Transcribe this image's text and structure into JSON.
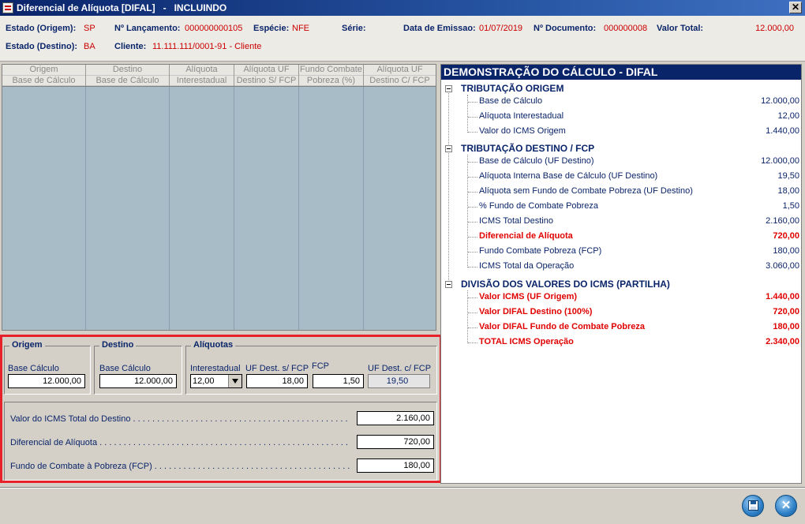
{
  "window": {
    "title": "Diferencial de Alíquota [DIFAL]",
    "separator": "-",
    "mode": "INCLUINDO",
    "close_glyph": "✕"
  },
  "header": {
    "estado_origem_label": "Estado (Origem):",
    "estado_origem": "SP",
    "lancamento_label": "Nº Lançamento:",
    "lancamento": "000000000105",
    "especie_label": "Espécie:",
    "especie": "NFE",
    "serie_label": "Série:",
    "data_emissao_label": "Data de Emissao:",
    "data_emissao": "01/07/2019",
    "documento_label": "Nº Documento:",
    "documento": "000000008",
    "valor_total_label": "Valor Total:",
    "valor_total": "12.000,00",
    "estado_destino_label": "Estado (Destino):",
    "estado_destino": "BA",
    "cliente_label": "Cliente:",
    "cliente": "11.111.111/0001-91 - Cliente"
  },
  "grid": {
    "columns": [
      {
        "line1": "Origem",
        "line2": "Base de Cálculo"
      },
      {
        "line1": "Destino",
        "line2": "Base de Cálculo"
      },
      {
        "line1": "Alíquota",
        "line2": "Interestadual"
      },
      {
        "line1": "Alíquota UF",
        "line2": "Destino S/ FCP"
      },
      {
        "line1": "Fundo Combate",
        "line2": "Pobreza (%)"
      },
      {
        "line1": "Alíquota UF",
        "line2": "Destino C/ FCP"
      }
    ]
  },
  "form": {
    "origem": {
      "legend": "Origem",
      "base_label": "Base Cálculo",
      "base_value": "12.000,00"
    },
    "destino": {
      "legend": "Destino",
      "base_label": "Base Cálculo",
      "base_value": "12.000,00"
    },
    "aliquotas": {
      "legend": "Alíquotas",
      "interestadual_label": "Interestadual",
      "interestadual_value": "12,00",
      "uf_sfcp_label": "UF Dest. s/ FCP",
      "uf_sfcp_value": "18,00",
      "fcp_label": "FCP",
      "fcp_value": "1,50",
      "uf_cfcp_label": "UF Dest. c/ FCP",
      "uf_cfcp_value": "19,50"
    },
    "totals": [
      {
        "label": "Valor do ICMS Total do Destino . . . . . . . . . . . . . . . . . . . . . . . . . . . . . . . . . . . . . . . . . . . . . . . . . . :",
        "value": "2.160,00"
      },
      {
        "label": "Diferencial de Alíquota . . . . . . . . . . . . . . . . . . . . . . . . . . . . . . . . . . . . . . . . . . . . . . . . . . . . . . . . . . :",
        "value": "720,00"
      },
      {
        "label": "Fundo de Combate à Pobreza (FCP) . . . . . . . . . . . . . . . . . . . . . . . . . . . . . . . . . . . . . . . . . . . . . . . :",
        "value": "180,00"
      }
    ]
  },
  "demo": {
    "title": "DEMONSTRAÇÃO DO CÁLCULO - DIFAL",
    "sections": [
      {
        "title": "TRIBUTAÇÃO ORIGEM",
        "rows": [
          {
            "label": "Base de Cálculo",
            "value": "12.000,00",
            "highlight": false
          },
          {
            "label": "Alíquota Interestadual",
            "value": "12,00",
            "highlight": false
          },
          {
            "label": "Valor do ICMS Origem",
            "value": "1.440,00",
            "highlight": false
          }
        ]
      },
      {
        "title": "TRIBUTAÇÃO DESTINO / FCP",
        "rows": [
          {
            "label": "Base de Cálculo (UF Destino)",
            "value": "12.000,00",
            "highlight": false
          },
          {
            "label": "Alíquota Interna Base de Cálculo (UF Destino)",
            "value": "19,50",
            "highlight": false
          },
          {
            "label": "Alíquota sem Fundo de Combate Pobreza (UF Destino)",
            "value": "18,00",
            "highlight": false
          },
          {
            "label": "% Fundo de Combate Pobreza",
            "value": "1,50",
            "highlight": false
          },
          {
            "label": "ICMS Total Destino",
            "value": "2.160,00",
            "highlight": false
          },
          {
            "label": "Diferencial de Alíquota",
            "value": "720,00",
            "highlight": true
          },
          {
            "label": "Fundo Combate Pobreza (FCP)",
            "value": "180,00",
            "highlight": false
          },
          {
            "label": "ICMS Total da Operação",
            "value": "3.060,00",
            "highlight": false
          }
        ]
      },
      {
        "title": "DIVISÃO DOS VALORES DO ICMS (PARTILHA)",
        "rows": [
          {
            "label": "Valor ICMS (UF Origem)",
            "value": "1.440,00",
            "highlight": true
          },
          {
            "label": "Valor DIFAL Destino (100%)",
            "value": "720,00",
            "highlight": true
          },
          {
            "label": "Valor DIFAL Fundo de Combate Pobreza",
            "value": "180,00",
            "highlight": true
          },
          {
            "label": "TOTAL ICMS Operação",
            "value": "2.340,00",
            "highlight": true
          }
        ]
      }
    ]
  },
  "colors": {
    "title_bar": "#0a246a",
    "label_blue": "#0a246a",
    "value_red": "#cc0000",
    "highlight_box": "#e8202a",
    "grid_background": "#a8bcc8"
  },
  "icons": {
    "save": "save-icon",
    "close": "close-icon"
  }
}
